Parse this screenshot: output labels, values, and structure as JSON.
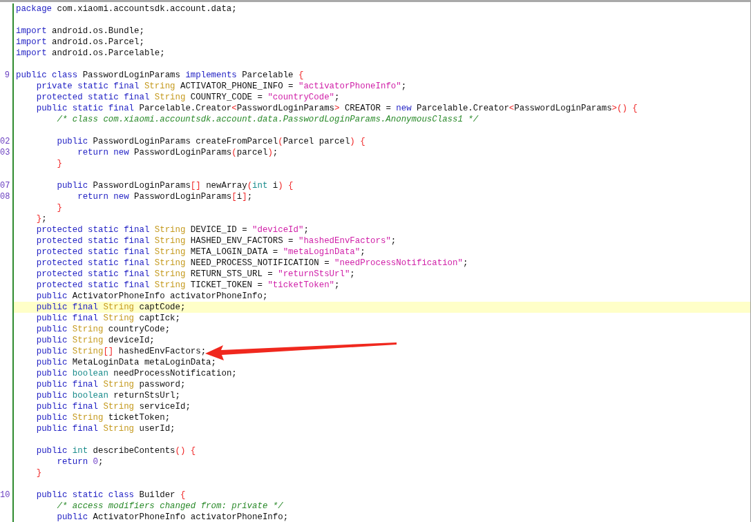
{
  "editor": {
    "lines": [
      {
        "current": false,
        "tokens": [
          {
            "kind": "keyword",
            "text": "package"
          },
          {
            "kind": "plain",
            "text": " com.xiaomi.accountsdk.account.data;"
          }
        ]
      },
      {
        "current": false
      },
      {
        "current": false,
        "tokens": [
          {
            "kind": "keyword",
            "text": "import"
          },
          {
            "kind": "plain",
            "text": " android.os.Bundle;"
          }
        ]
      },
      {
        "current": false,
        "tokens": [
          {
            "kind": "keyword",
            "text": "import"
          },
          {
            "kind": "plain",
            "text": " android.os.Parcel;"
          }
        ]
      },
      {
        "current": false,
        "tokens": [
          {
            "kind": "keyword",
            "text": "import"
          },
          {
            "kind": "plain",
            "text": " android.os.Parcelable;"
          }
        ]
      },
      {
        "current": false
      },
      {
        "number": "9",
        "current": false,
        "tokens": [
          {
            "kind": "keyword",
            "text": "public class"
          },
          {
            "kind": "plain",
            "text": " PasswordLoginParams "
          },
          {
            "kind": "keyword",
            "text": "implements"
          },
          {
            "kind": "plain",
            "text": " Parcelable "
          },
          {
            "kind": "bracket",
            "text": "{"
          }
        ]
      },
      {
        "current": false,
        "tokens": [
          {
            "kind": "keyword",
            "text": "    private static final "
          },
          {
            "kind": "type",
            "text": "String"
          },
          {
            "kind": "plain",
            "text": " ACTIVATOR_PHONE_INFO = "
          },
          {
            "kind": "string",
            "text": "\"activatorPhoneInfo\""
          },
          {
            "kind": "plain",
            "text": ";"
          }
        ]
      },
      {
        "current": false,
        "tokens": [
          {
            "kind": "keyword",
            "text": "    protected static final "
          },
          {
            "kind": "type",
            "text": "String"
          },
          {
            "kind": "plain",
            "text": " COUNTRY_CODE = "
          },
          {
            "kind": "string",
            "text": "\"countryCode\""
          },
          {
            "kind": "plain",
            "text": ";"
          }
        ]
      },
      {
        "current": false,
        "tokens": [
          {
            "kind": "keyword",
            "text": "    public static final"
          },
          {
            "kind": "plain",
            "text": " Parcelable.Creator"
          },
          {
            "kind": "bracket",
            "text": "<"
          },
          {
            "kind": "plain",
            "text": "PasswordLoginParams"
          },
          {
            "kind": "bracket",
            "text": ">"
          },
          {
            "kind": "plain",
            "text": " CREATOR = "
          },
          {
            "kind": "keyword",
            "text": "new"
          },
          {
            "kind": "plain",
            "text": " Parcelable.Creator"
          },
          {
            "kind": "bracket",
            "text": "<"
          },
          {
            "kind": "plain",
            "text": "PasswordLoginParams"
          },
          {
            "kind": "bracket",
            "text": ">() {"
          }
        ]
      },
      {
        "current": false,
        "tokens": [
          {
            "kind": "comment",
            "text": "        /* class com.xiaomi.accountsdk.account.data.PasswordLoginParams.AnonymousClass1 */"
          }
        ]
      },
      {
        "current": false
      },
      {
        "number": "02",
        "current": false,
        "tokens": [
          {
            "kind": "keyword",
            "text": "        public"
          },
          {
            "kind": "plain",
            "text": " PasswordLoginParams createFromParcel"
          },
          {
            "kind": "bracket",
            "text": "("
          },
          {
            "kind": "plain",
            "text": "Parcel parcel"
          },
          {
            "kind": "bracket",
            "text": ") {"
          }
        ]
      },
      {
        "number": "03",
        "current": false,
        "tokens": [
          {
            "kind": "keyword",
            "text": "            return new"
          },
          {
            "kind": "plain",
            "text": " PasswordLoginParams"
          },
          {
            "kind": "bracket",
            "text": "("
          },
          {
            "kind": "plain",
            "text": "parcel"
          },
          {
            "kind": "bracket",
            "text": ")"
          },
          {
            "kind": "plain",
            "text": ";"
          }
        ]
      },
      {
        "current": false,
        "tokens": [
          {
            "kind": "bracket",
            "text": "        }"
          }
        ]
      },
      {
        "current": false
      },
      {
        "number": "07",
        "current": false,
        "tokens": [
          {
            "kind": "keyword",
            "text": "        public"
          },
          {
            "kind": "plain",
            "text": " PasswordLoginParams"
          },
          {
            "kind": "bracket",
            "text": "[]"
          },
          {
            "kind": "plain",
            "text": " newArray"
          },
          {
            "kind": "bracket",
            "text": "("
          },
          {
            "kind": "primitive",
            "text": "int"
          },
          {
            "kind": "plain",
            "text": " i"
          },
          {
            "kind": "bracket",
            "text": ") {"
          }
        ]
      },
      {
        "number": "08",
        "current": false,
        "tokens": [
          {
            "kind": "keyword",
            "text": "            return new"
          },
          {
            "kind": "plain",
            "text": " PasswordLoginParams"
          },
          {
            "kind": "bracket",
            "text": "["
          },
          {
            "kind": "plain",
            "text": "i"
          },
          {
            "kind": "bracket",
            "text": "]"
          },
          {
            "kind": "plain",
            "text": ";"
          }
        ]
      },
      {
        "current": false,
        "tokens": [
          {
            "kind": "bracket",
            "text": "        }"
          }
        ]
      },
      {
        "current": false,
        "tokens": [
          {
            "kind": "bracket",
            "text": "    }"
          },
          {
            "kind": "plain",
            "text": ";"
          }
        ]
      },
      {
        "current": false,
        "tokens": [
          {
            "kind": "keyword",
            "text": "    protected static final "
          },
          {
            "kind": "type",
            "text": "String"
          },
          {
            "kind": "plain",
            "text": " DEVICE_ID = "
          },
          {
            "kind": "string",
            "text": "\"deviceId\""
          },
          {
            "kind": "plain",
            "text": ";"
          }
        ]
      },
      {
        "current": false,
        "tokens": [
          {
            "kind": "keyword",
            "text": "    protected static final "
          },
          {
            "kind": "type",
            "text": "String"
          },
          {
            "kind": "plain",
            "text": " HASHED_ENV_FACTORS = "
          },
          {
            "kind": "string",
            "text": "\"hashedEnvFactors\""
          },
          {
            "kind": "plain",
            "text": ";"
          }
        ]
      },
      {
        "current": false,
        "tokens": [
          {
            "kind": "keyword",
            "text": "    protected static final "
          },
          {
            "kind": "type",
            "text": "String"
          },
          {
            "kind": "plain",
            "text": " META_LOGIN_DATA = "
          },
          {
            "kind": "string",
            "text": "\"metaLoginData\""
          },
          {
            "kind": "plain",
            "text": ";"
          }
        ]
      },
      {
        "current": false,
        "tokens": [
          {
            "kind": "keyword",
            "text": "    protected static final "
          },
          {
            "kind": "type",
            "text": "String"
          },
          {
            "kind": "plain",
            "text": " NEED_PROCESS_NOTIFICATION = "
          },
          {
            "kind": "string",
            "text": "\"needProcessNotification\""
          },
          {
            "kind": "plain",
            "text": ";"
          }
        ]
      },
      {
        "current": false,
        "tokens": [
          {
            "kind": "keyword",
            "text": "    protected static final "
          },
          {
            "kind": "type",
            "text": "String"
          },
          {
            "kind": "plain",
            "text": " RETURN_STS_URL = "
          },
          {
            "kind": "string",
            "text": "\"returnStsUrl\""
          },
          {
            "kind": "plain",
            "text": ";"
          }
        ]
      },
      {
        "current": false,
        "tokens": [
          {
            "kind": "keyword",
            "text": "    protected static final "
          },
          {
            "kind": "type",
            "text": "String"
          },
          {
            "kind": "plain",
            "text": " TICKET_TOKEN = "
          },
          {
            "kind": "string",
            "text": "\"ticketToken\""
          },
          {
            "kind": "plain",
            "text": ";"
          }
        ]
      },
      {
        "current": false,
        "tokens": [
          {
            "kind": "keyword",
            "text": "    public"
          },
          {
            "kind": "plain",
            "text": " ActivatorPhoneInfo activatorPhoneInfo;"
          }
        ]
      },
      {
        "current": true,
        "tokens": [
          {
            "kind": "keyword",
            "text": "    public final "
          },
          {
            "kind": "type",
            "text": "String"
          },
          {
            "kind": "plain",
            "text": " captCode;"
          }
        ]
      },
      {
        "current": false,
        "tokens": [
          {
            "kind": "keyword",
            "text": "    public final "
          },
          {
            "kind": "type",
            "text": "String"
          },
          {
            "kind": "plain",
            "text": " captIck;"
          }
        ]
      },
      {
        "current": false,
        "tokens": [
          {
            "kind": "keyword",
            "text": "    public "
          },
          {
            "kind": "type",
            "text": "String"
          },
          {
            "kind": "plain",
            "text": " countryCode;"
          }
        ]
      },
      {
        "current": false,
        "tokens": [
          {
            "kind": "keyword",
            "text": "    public "
          },
          {
            "kind": "type",
            "text": "String"
          },
          {
            "kind": "plain",
            "text": " deviceId;"
          }
        ]
      },
      {
        "current": false,
        "tokens": [
          {
            "kind": "keyword",
            "text": "    public "
          },
          {
            "kind": "type",
            "text": "String"
          },
          {
            "kind": "bracket",
            "text": "[]"
          },
          {
            "kind": "plain",
            "text": " hashedEnvFactors;"
          }
        ]
      },
      {
        "current": false,
        "tokens": [
          {
            "kind": "keyword",
            "text": "    public"
          },
          {
            "kind": "plain",
            "text": " MetaLoginData metaLoginData;"
          }
        ]
      },
      {
        "current": false,
        "tokens": [
          {
            "kind": "keyword",
            "text": "    public "
          },
          {
            "kind": "primitive",
            "text": "boolean"
          },
          {
            "kind": "plain",
            "text": " needProcessNotification;"
          }
        ]
      },
      {
        "current": false,
        "tokens": [
          {
            "kind": "keyword",
            "text": "    public final "
          },
          {
            "kind": "type",
            "text": "String"
          },
          {
            "kind": "plain",
            "text": " password;"
          }
        ]
      },
      {
        "current": false,
        "tokens": [
          {
            "kind": "keyword",
            "text": "    public "
          },
          {
            "kind": "primitive",
            "text": "boolean"
          },
          {
            "kind": "plain",
            "text": " returnStsUrl;"
          }
        ]
      },
      {
        "current": false,
        "tokens": [
          {
            "kind": "keyword",
            "text": "    public final "
          },
          {
            "kind": "type",
            "text": "String"
          },
          {
            "kind": "plain",
            "text": " serviceId;"
          }
        ]
      },
      {
        "current": false,
        "tokens": [
          {
            "kind": "keyword",
            "text": "    public "
          },
          {
            "kind": "type",
            "text": "String"
          },
          {
            "kind": "plain",
            "text": " ticketToken;"
          }
        ]
      },
      {
        "current": false,
        "tokens": [
          {
            "kind": "keyword",
            "text": "    public final "
          },
          {
            "kind": "type",
            "text": "String"
          },
          {
            "kind": "plain",
            "text": " userId;"
          }
        ]
      },
      {
        "current": false
      },
      {
        "current": false,
        "tokens": [
          {
            "kind": "keyword",
            "text": "    public "
          },
          {
            "kind": "primitive",
            "text": "int"
          },
          {
            "kind": "plain",
            "text": " describeContents"
          },
          {
            "kind": "bracket",
            "text": "() {"
          }
        ]
      },
      {
        "current": false,
        "tokens": [
          {
            "kind": "keyword",
            "text": "        return "
          },
          {
            "kind": "number",
            "text": "0"
          },
          {
            "kind": "plain",
            "text": ";"
          }
        ]
      },
      {
        "current": false,
        "tokens": [
          {
            "kind": "bracket",
            "text": "    }"
          }
        ]
      },
      {
        "current": false
      },
      {
        "number": "10",
        "current": false,
        "tokens": [
          {
            "kind": "keyword",
            "text": "    public static class"
          },
          {
            "kind": "plain",
            "text": " Builder "
          },
          {
            "kind": "bracket",
            "text": "{"
          }
        ]
      },
      {
        "current": false,
        "tokens": [
          {
            "kind": "comment",
            "text": "        /* access modifiers changed from: private */"
          }
        ]
      },
      {
        "current": false,
        "tokens": [
          {
            "kind": "keyword",
            "text": "        public"
          },
          {
            "kind": "plain",
            "text": " ActivatorPhoneInfo activatorPhoneInfo;"
          }
        ]
      }
    ]
  }
}
